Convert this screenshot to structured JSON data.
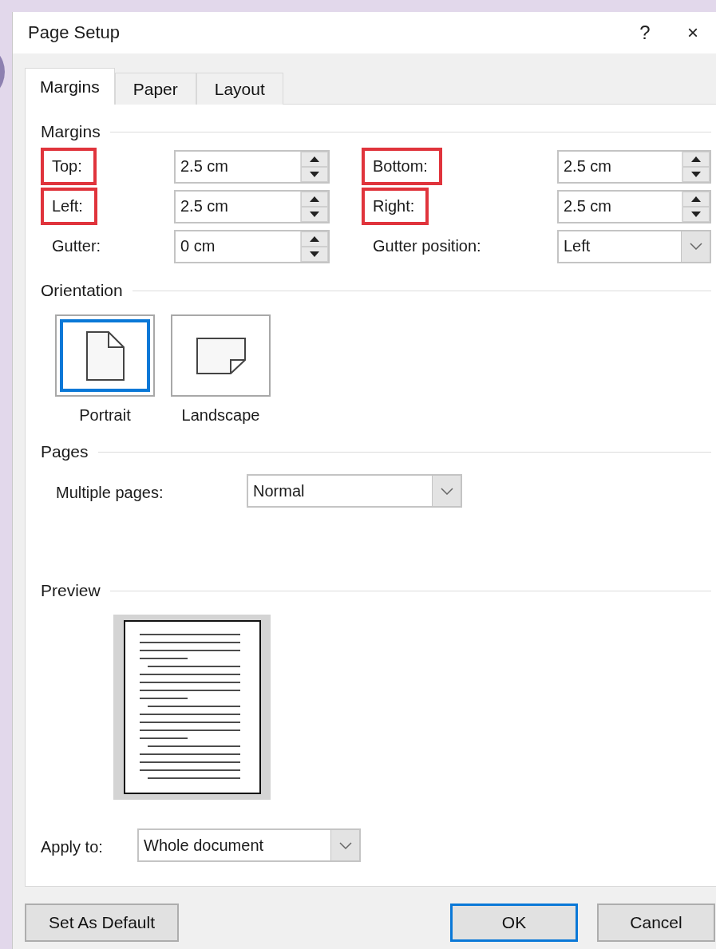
{
  "window": {
    "title": "Page Setup",
    "help": "?",
    "close": "×"
  },
  "tabs": [
    {
      "label": "Margins",
      "selected": true
    },
    {
      "label": "Paper",
      "selected": false
    },
    {
      "label": "Layout",
      "selected": false
    }
  ],
  "margins": {
    "heading": "Margins",
    "fields": [
      {
        "label": "Top:",
        "value": "2.5 cm",
        "kind": "spin",
        "highlighted": true
      },
      {
        "label": "Bottom:",
        "value": "2.5 cm",
        "kind": "spin",
        "highlighted": true
      },
      {
        "label": "Left:",
        "value": "2.5 cm",
        "kind": "spin",
        "highlighted": true
      },
      {
        "label": "Right:",
        "value": "2.5 cm",
        "kind": "spin",
        "highlighted": true
      },
      {
        "label": "Gutter:",
        "value": "0 cm",
        "kind": "spin",
        "highlighted": false
      },
      {
        "label": "Gutter position:",
        "value": "Left",
        "kind": "dropdown",
        "highlighted": false
      }
    ]
  },
  "orientation": {
    "heading": "Orientation",
    "options": [
      {
        "label": "Portrait",
        "kind": "portrait",
        "selected": true
      },
      {
        "label": "Landscape",
        "kind": "landscape",
        "selected": false
      }
    ]
  },
  "pages": {
    "heading": "Pages",
    "multiple_pages": {
      "label": "Multiple pages:",
      "value": "Normal"
    }
  },
  "preview": {
    "heading": "Preview"
  },
  "apply_to": {
    "label": "Apply to:",
    "value": "Whole document"
  },
  "buttons": [
    {
      "label": "Set As Default",
      "default": false
    },
    {
      "label": "OK",
      "default": true
    },
    {
      "label": "Cancel",
      "default": false
    }
  ]
}
